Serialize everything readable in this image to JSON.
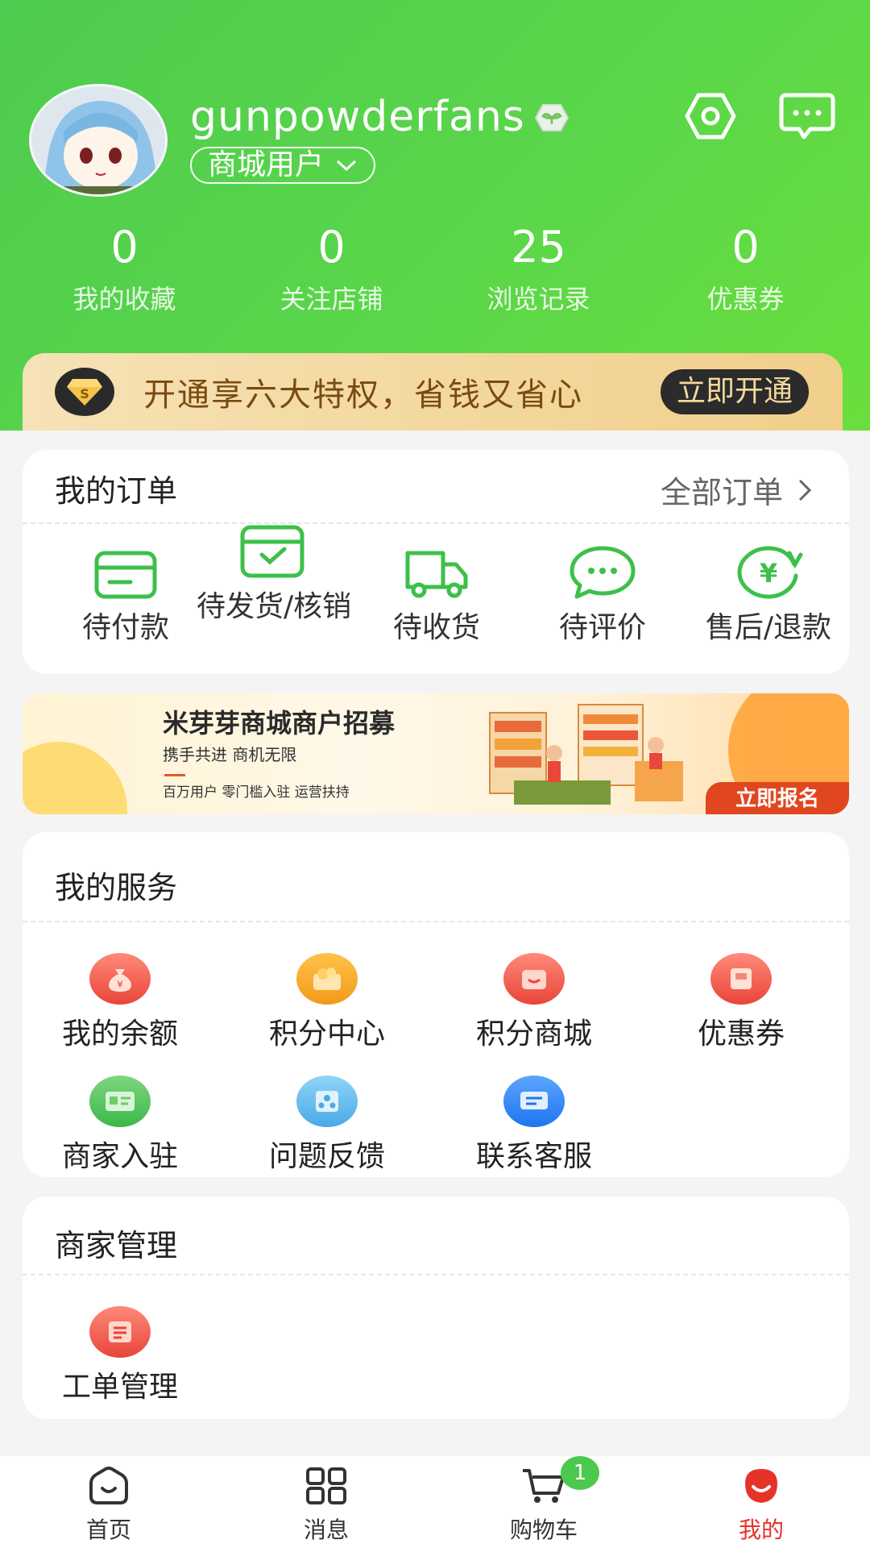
{
  "profile": {
    "username": "gunpowderfans",
    "role": "商城用户",
    "stats": [
      {
        "value": "0",
        "label": "我的收藏"
      },
      {
        "value": "0",
        "label": "关注店铺"
      },
      {
        "value": "25",
        "label": "浏览记录"
      },
      {
        "value": "0",
        "label": "优惠券"
      }
    ]
  },
  "vip": {
    "text": "开通享六大特权，省钱又省心",
    "button": "立即开通"
  },
  "orders": {
    "title": "我的订单",
    "all_label": "全部订单",
    "items": [
      {
        "label": "待付款",
        "icon": "wallet-icon"
      },
      {
        "label": "待发货/核销",
        "icon": "box-check-icon"
      },
      {
        "label": "待收货",
        "icon": "truck-icon"
      },
      {
        "label": "待评价",
        "icon": "chat-dots-icon"
      },
      {
        "label": "售后/退款",
        "icon": "yen-refresh-icon"
      }
    ]
  },
  "recruit_banner": {
    "title": "米芽芽商城商户招募",
    "subtitle": "携手共进 商机无限",
    "features": "百万用户 零门槛入驻 运营扶持",
    "button": "立即报名"
  },
  "services": {
    "title": "我的服务",
    "items": [
      {
        "label": "我的余额",
        "icon": "money-bag-icon"
      },
      {
        "label": "积分中心",
        "icon": "points-wallet-icon"
      },
      {
        "label": "积分商城",
        "icon": "points-store-icon"
      },
      {
        "label": "优惠券",
        "icon": "coupon-icon"
      },
      {
        "label": "商家入驻",
        "icon": "merchant-card-icon"
      },
      {
        "label": "问题反馈",
        "icon": "feedback-icon"
      },
      {
        "label": "联系客服",
        "icon": "customer-service-icon"
      }
    ]
  },
  "merchant": {
    "title": "商家管理",
    "items": [
      {
        "label": "工单管理",
        "icon": "ticket-list-icon"
      }
    ]
  },
  "tabbar": {
    "items": [
      {
        "label": "首页",
        "icon": "home-icon"
      },
      {
        "label": "消息",
        "icon": "grid-icon"
      },
      {
        "label": "购物车",
        "icon": "cart-icon",
        "badge": "1"
      },
      {
        "label": "我的",
        "icon": "profile-icon",
        "active": true
      }
    ]
  },
  "colors": {
    "header_green": "#4ecb4e",
    "accent_green": "#3cc04a",
    "active_red": "#e6332a",
    "vip_gold": "#f0cf8a"
  }
}
